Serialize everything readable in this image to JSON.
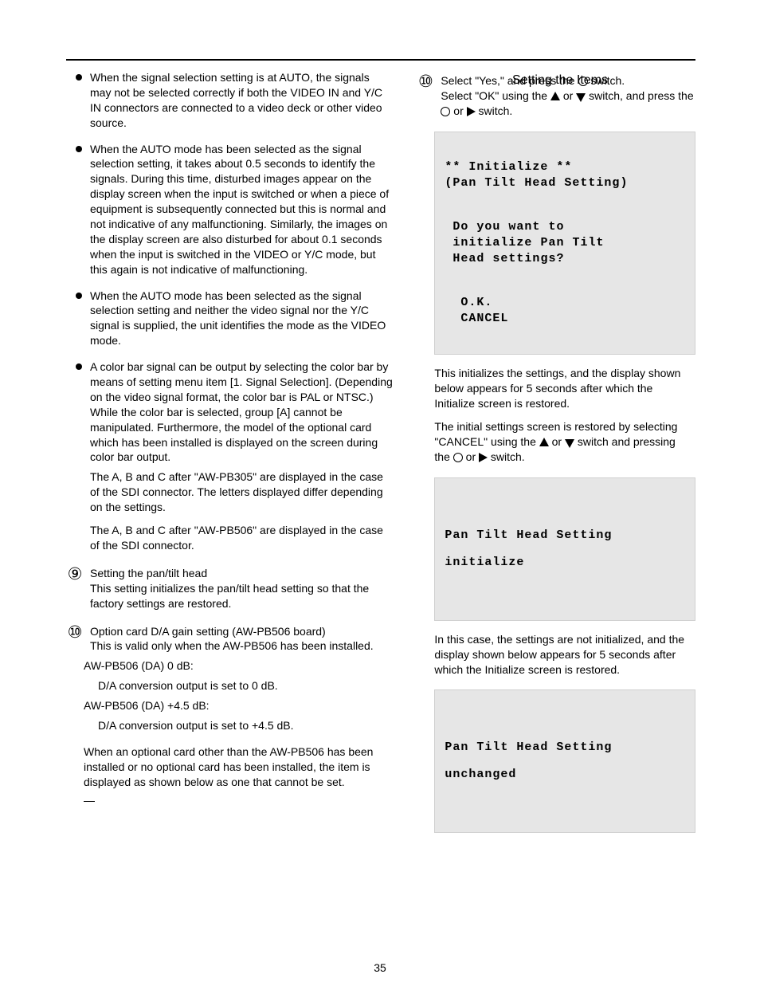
{
  "header_title": "Setting the Items",
  "page_number": "35",
  "left": {
    "bullets": [
      "When the signal selection setting is at AUTO, the signals may not be selected correctly if both the VIDEO IN and Y/C IN connectors are connected to a video deck or other video source.",
      "When the AUTO mode has been selected as the signal selection setting, it takes about 0.5 seconds to identify the signals. During this time, disturbed images appear on the display screen when the input is switched or when a piece of equipment is subsequently connected but this is normal and not indicative of any malfunctioning. Similarly, the images on the display screen are also disturbed for about 0.1 seconds when the input is switched in the VIDEO or Y/C mode, but this again is not indicative of malfunctioning.",
      "When the AUTO mode has been selected as the signal selection setting and neither the video signal nor the Y/C signal is supplied, the unit identifies the mode as the VIDEO mode.",
      "A color bar signal can be output by selecting the color bar by means of setting menu item [1. Signal Selection]. (Depending on the video signal format, the color bar is PAL or NTSC.) While the color bar is selected, group [A] cannot be manipulated. Furthermore, the model of the optional card which has been installed is displayed on the screen during color bar output."
    ],
    "note1a": "The A, B and C after \"AW-PB305\" are displayed in the case of the SDI connector. The letters displayed differ depending on the settings.",
    "note1b": "The A, B and C after \"AW-PB506\" are displayed in the case of the SDI connector.",
    "step9_lead": "Setting the pan/tilt head",
    "step9_body": "This setting initializes the pan/tilt head setting so that the factory settings are restored.",
    "step10_lead": "Option card D/A gain setting (AW-PB506 board)",
    "step10_body": "This is valid only when the AW-PB506 has been installed.",
    "step10_lines": [
      "AW-PB506 (DA) 0 dB:",
      "D/A conversion output is set to 0 dB.",
      "AW-PB506 (DA) +4.5 dB:",
      "D/A conversion output is set to +4.5 dB."
    ],
    "step10_note": "When an optional card other than the AW-PB506 has been installed or no optional card has been installed, the item is displayed as shown below as one that cannot be set.",
    "no_item": "—"
  },
  "right": {
    "step10": {
      "num": "⑩",
      "line1": "Select \"Yes,\" and press the ",
      "line1_suffix": " switch.",
      "line2": "Select \"OK\" using the ",
      "line2_mid": " or ",
      "line2_end": " switch, and press the",
      "line3_lead_gap": " ",
      "line3_mid": " or ",
      "line3_end": " switch."
    },
    "screen1": {
      "l1": "** Initialize **",
      "l2": "(Pan Tilt Head Setting)",
      "l3": " Do you want to",
      "l4": " initialize Pan Tilt",
      "l5": " Head settings?",
      "l6": "  O.K.",
      "l7": "  CANCEL"
    },
    "after1a": "This initializes the settings, and the display shown below appears for 5 seconds after which the Initialize screen is restored.",
    "after1b": "The initial settings screen is restored by selecting \"CANCEL\" using the ",
    "after1b_mid": " or ",
    "after1b_end": " switch and pressing",
    "after1c_pre": "the ",
    "after1c_mid": " or ",
    "after1c_end": " switch.",
    "screen2": {
      "l1": "Pan Tilt Head Setting",
      "l2": "initialize"
    },
    "after2a": "In this case, the settings are not initialized, and the display shown below appears for 5 seconds after which the Initialize screen is restored.",
    "screen3": {
      "l1": "Pan Tilt Head Setting",
      "l2": "unchanged"
    }
  }
}
